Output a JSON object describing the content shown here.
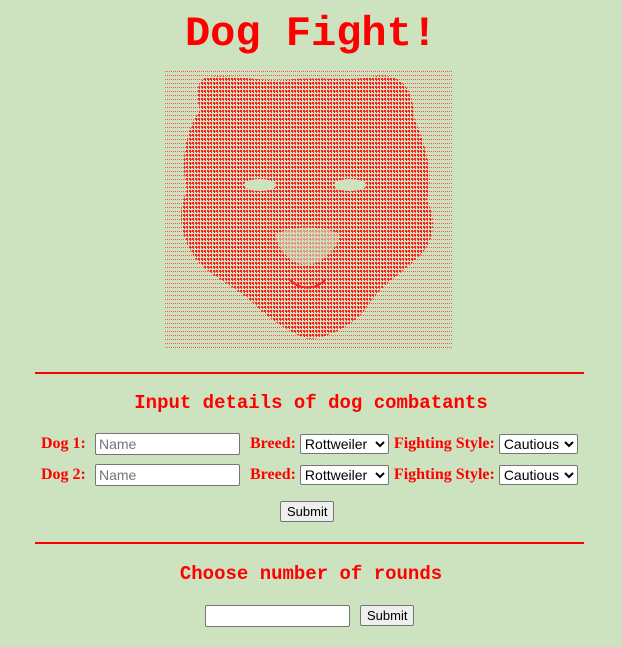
{
  "title": "Dog Fight!",
  "colors": {
    "background": "#cde3c0",
    "accent": "#ff0000"
  },
  "combatants_heading": "Input details of dog combatants",
  "dogs": [
    {
      "label": "Dog 1:",
      "name_placeholder": "Name",
      "breed_label": "Breed:",
      "breed_value": "Rottweiler",
      "style_label": "Fighting Style:",
      "style_value": "Cautious"
    },
    {
      "label": "Dog 2:",
      "name_placeholder": "Name",
      "breed_label": "Breed:",
      "breed_value": "Rottweiler",
      "style_label": "Fighting Style:",
      "style_value": "Cautious"
    }
  ],
  "combatants_submit": "Submit",
  "rounds_heading": "Choose number of rounds",
  "rounds_value": "",
  "rounds_submit": "Submit"
}
